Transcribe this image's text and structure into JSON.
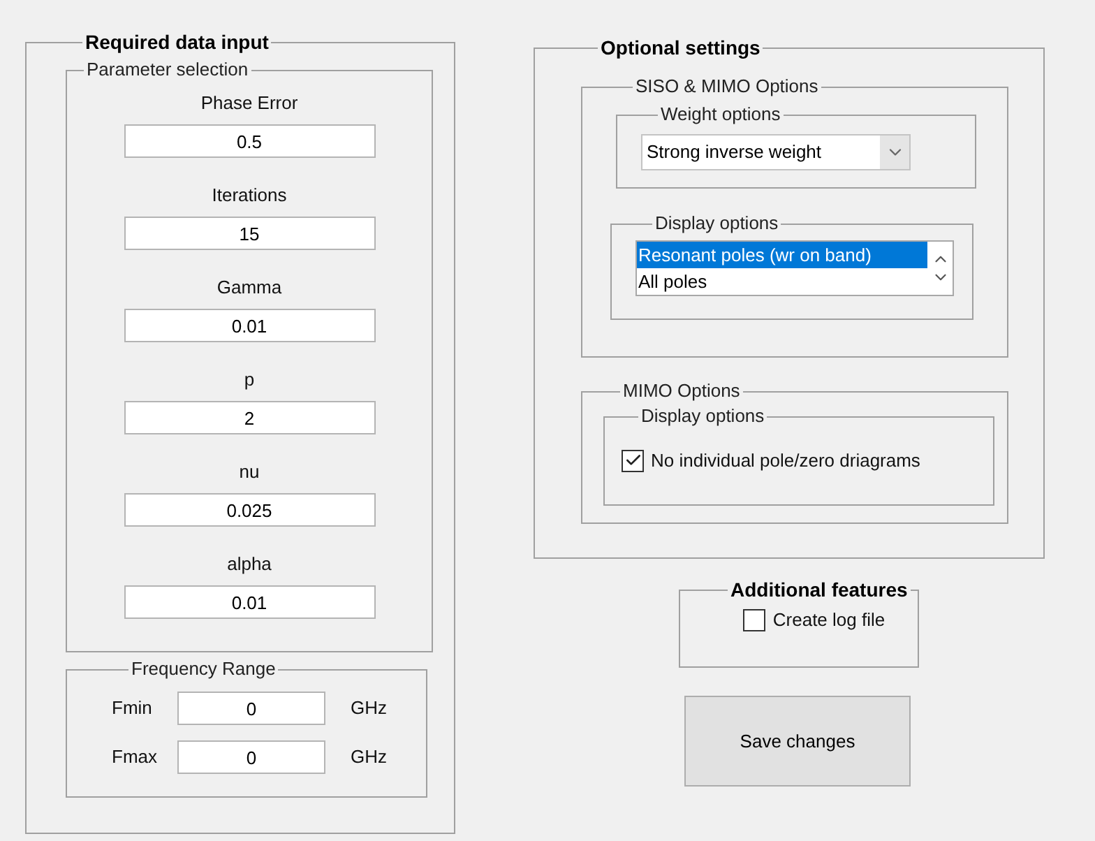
{
  "required_data_input": {
    "title": "Required data input",
    "parameter_selection": {
      "title": "Parameter selection",
      "parameters": [
        {
          "label": "Phase Error",
          "value": "0.5"
        },
        {
          "label": "Iterations",
          "value": "15"
        },
        {
          "label": "Gamma",
          "value": "0.01"
        },
        {
          "label": "p",
          "value": "2"
        },
        {
          "label": "nu",
          "value": "0.025"
        },
        {
          "label": "alpha",
          "value": "0.01"
        }
      ]
    },
    "frequency_range": {
      "title": "Frequency Range",
      "rows": [
        {
          "label": "Fmin",
          "value": "0",
          "unit": "GHz"
        },
        {
          "label": "Fmax",
          "value": "0",
          "unit": "GHz"
        }
      ]
    }
  },
  "optional_settings": {
    "title": "Optional settings",
    "siso_mimo_options": {
      "title": "SISO & MIMO Options",
      "weight_options": {
        "title": "Weight options",
        "dropdown": {
          "value": "Strong inverse weight"
        }
      },
      "display_options": {
        "title": "Display options",
        "items": [
          {
            "label": "Resonant poles (wr on band)",
            "selected": true
          },
          {
            "label": "All poles",
            "selected": false
          }
        ]
      }
    },
    "mimo_options": {
      "title": "MIMO Options",
      "display_options": {
        "title": "Display options",
        "checkbox": {
          "label": "No individual pole/zero driagrams",
          "checked": true
        }
      }
    }
  },
  "additional_features": {
    "title": "Additional features",
    "checkbox": {
      "label": "Create log file",
      "checked": false
    }
  },
  "save_button": {
    "label": "Save changes"
  }
}
